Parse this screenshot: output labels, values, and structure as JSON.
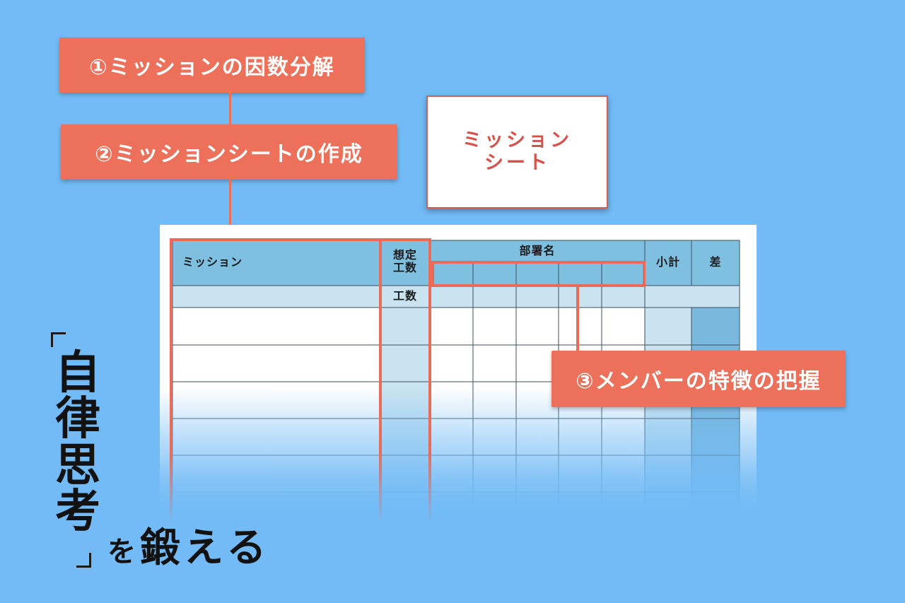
{
  "steps": {
    "step1": "①ミッションの因数分解",
    "step2": "②ミッションシートの作成",
    "step3": "③メンバーの特徴の把握"
  },
  "mission_card": {
    "label": "ミッション\nシート"
  },
  "sheet": {
    "headers": {
      "mission": "ミッション",
      "estimated_hours": "想定\n工数",
      "hours": "工数",
      "department": "部署名",
      "subtotal": "小計",
      "difference": "差"
    },
    "department_columns": 5,
    "body_rows": 6
  },
  "title": {
    "vertical": "自\n律\n思\n考",
    "tail_particle": "を",
    "tail": "鍛える"
  },
  "colors": {
    "background": "#72bbf6",
    "accent": "#ed705a",
    "header_blue": "#7fbfe0",
    "light_blue": "#c9e3f0",
    "column_blue": "#7ab8dd"
  }
}
